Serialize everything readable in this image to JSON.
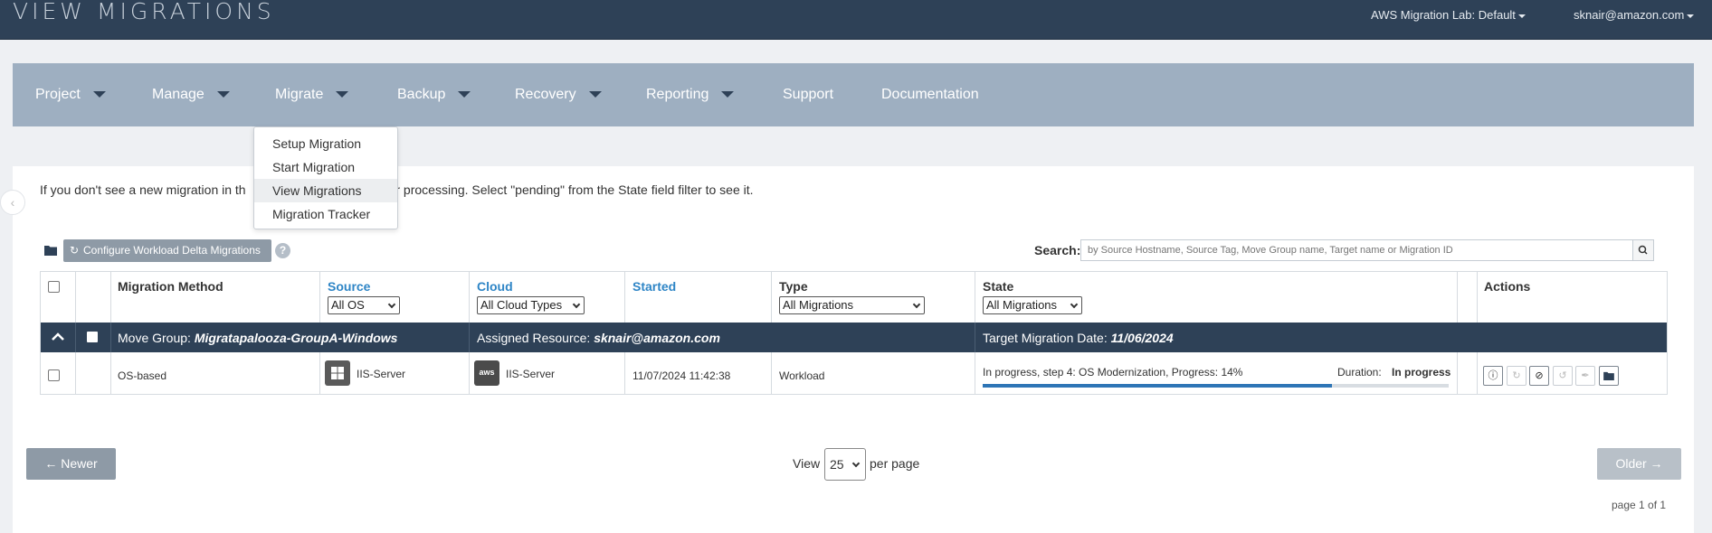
{
  "header": {
    "title": "VIEW MIGRATIONS",
    "lab_selector": "AWS Migration Lab: Default",
    "user_menu": "sknair@amazon.com"
  },
  "nav": {
    "items": [
      "Project",
      "Manage",
      "Migrate",
      "Backup",
      "Recovery",
      "Reporting",
      "Support",
      "Documentation"
    ]
  },
  "migrate_menu": {
    "items": [
      "Setup Migration",
      "Start Migration",
      "View Migrations",
      "Migration Tracker"
    ],
    "active": "View Migrations"
  },
  "notice": {
    "left": "If you don't see a new migration in th",
    "right": "or processing. Select \"pending\" from the State field filter to see it."
  },
  "toolbar": {
    "configure_label": "Configure Workload Delta Migrations",
    "search_label": "Search:",
    "search_placeholder": "by Source Hostname, Source Tag, Move Group name, Target name or Migration ID"
  },
  "table": {
    "headers": {
      "method": "Migration Method",
      "source": "Source",
      "cloud": "Cloud",
      "started": "Started",
      "type": "Type",
      "state": "State",
      "actions": "Actions"
    },
    "filters": {
      "source": "All OS",
      "cloud": "All Cloud Types",
      "type": "All Migrations",
      "state": "All Migrations"
    },
    "group": {
      "move_group_label": "Move Group:",
      "move_group_value": "Migratapalooza-GroupA-Windows",
      "assigned_label": "Assigned Resource:",
      "assigned_value": "sknair@amazon.com",
      "target_label": "Target Migration Date:",
      "target_value": "11/06/2024"
    },
    "rows": [
      {
        "method": "OS-based",
        "source": "IIS-Server",
        "cloud_logo": "aws",
        "cloud": "IIS-Server",
        "started": "11/07/2024 11:42:38",
        "type": "Workload",
        "state": "In progress, step 4: OS Modernization, Progress: 14%",
        "duration_label": "Duration:",
        "duration_value": "In progress",
        "progress": 0.75
      }
    ]
  },
  "pager": {
    "newer": "← Newer",
    "older": "Older →",
    "view_label": "View",
    "per_page_value": "25",
    "per_page_label": "per page",
    "page_info": "page 1 of 1"
  },
  "colors": {
    "header_bg": "#2e4157",
    "nav_bg": "#9eafc1",
    "link": "#2e85c6",
    "progress": "#2e75b6"
  }
}
